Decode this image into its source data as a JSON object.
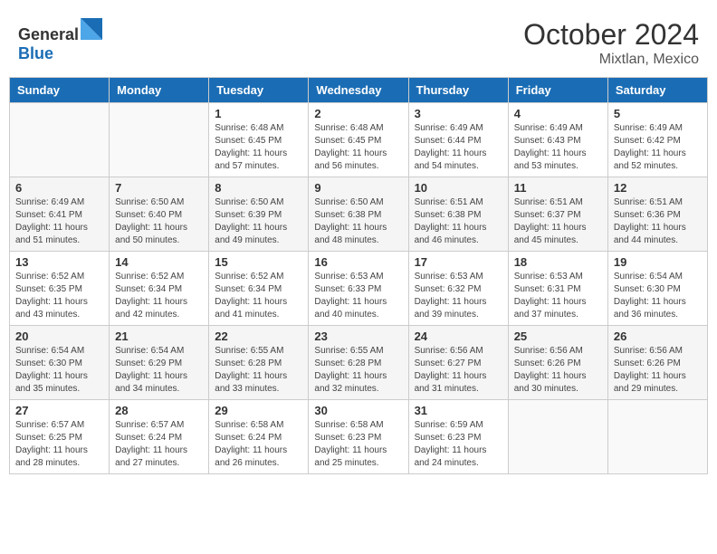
{
  "header": {
    "logo_general": "General",
    "logo_blue": "Blue",
    "month": "October 2024",
    "location": "Mixtlan, Mexico"
  },
  "weekdays": [
    "Sunday",
    "Monday",
    "Tuesday",
    "Wednesday",
    "Thursday",
    "Friday",
    "Saturday"
  ],
  "weeks": [
    [
      {
        "day": "",
        "info": ""
      },
      {
        "day": "",
        "info": ""
      },
      {
        "day": "1",
        "info": "Sunrise: 6:48 AM\nSunset: 6:45 PM\nDaylight: 11 hours and 57 minutes."
      },
      {
        "day": "2",
        "info": "Sunrise: 6:48 AM\nSunset: 6:45 PM\nDaylight: 11 hours and 56 minutes."
      },
      {
        "day": "3",
        "info": "Sunrise: 6:49 AM\nSunset: 6:44 PM\nDaylight: 11 hours and 54 minutes."
      },
      {
        "day": "4",
        "info": "Sunrise: 6:49 AM\nSunset: 6:43 PM\nDaylight: 11 hours and 53 minutes."
      },
      {
        "day": "5",
        "info": "Sunrise: 6:49 AM\nSunset: 6:42 PM\nDaylight: 11 hours and 52 minutes."
      }
    ],
    [
      {
        "day": "6",
        "info": "Sunrise: 6:49 AM\nSunset: 6:41 PM\nDaylight: 11 hours and 51 minutes."
      },
      {
        "day": "7",
        "info": "Sunrise: 6:50 AM\nSunset: 6:40 PM\nDaylight: 11 hours and 50 minutes."
      },
      {
        "day": "8",
        "info": "Sunrise: 6:50 AM\nSunset: 6:39 PM\nDaylight: 11 hours and 49 minutes."
      },
      {
        "day": "9",
        "info": "Sunrise: 6:50 AM\nSunset: 6:38 PM\nDaylight: 11 hours and 48 minutes."
      },
      {
        "day": "10",
        "info": "Sunrise: 6:51 AM\nSunset: 6:38 PM\nDaylight: 11 hours and 46 minutes."
      },
      {
        "day": "11",
        "info": "Sunrise: 6:51 AM\nSunset: 6:37 PM\nDaylight: 11 hours and 45 minutes."
      },
      {
        "day": "12",
        "info": "Sunrise: 6:51 AM\nSunset: 6:36 PM\nDaylight: 11 hours and 44 minutes."
      }
    ],
    [
      {
        "day": "13",
        "info": "Sunrise: 6:52 AM\nSunset: 6:35 PM\nDaylight: 11 hours and 43 minutes."
      },
      {
        "day": "14",
        "info": "Sunrise: 6:52 AM\nSunset: 6:34 PM\nDaylight: 11 hours and 42 minutes."
      },
      {
        "day": "15",
        "info": "Sunrise: 6:52 AM\nSunset: 6:34 PM\nDaylight: 11 hours and 41 minutes."
      },
      {
        "day": "16",
        "info": "Sunrise: 6:53 AM\nSunset: 6:33 PM\nDaylight: 11 hours and 40 minutes."
      },
      {
        "day": "17",
        "info": "Sunrise: 6:53 AM\nSunset: 6:32 PM\nDaylight: 11 hours and 39 minutes."
      },
      {
        "day": "18",
        "info": "Sunrise: 6:53 AM\nSunset: 6:31 PM\nDaylight: 11 hours and 37 minutes."
      },
      {
        "day": "19",
        "info": "Sunrise: 6:54 AM\nSunset: 6:30 PM\nDaylight: 11 hours and 36 minutes."
      }
    ],
    [
      {
        "day": "20",
        "info": "Sunrise: 6:54 AM\nSunset: 6:30 PM\nDaylight: 11 hours and 35 minutes."
      },
      {
        "day": "21",
        "info": "Sunrise: 6:54 AM\nSunset: 6:29 PM\nDaylight: 11 hours and 34 minutes."
      },
      {
        "day": "22",
        "info": "Sunrise: 6:55 AM\nSunset: 6:28 PM\nDaylight: 11 hours and 33 minutes."
      },
      {
        "day": "23",
        "info": "Sunrise: 6:55 AM\nSunset: 6:28 PM\nDaylight: 11 hours and 32 minutes."
      },
      {
        "day": "24",
        "info": "Sunrise: 6:56 AM\nSunset: 6:27 PM\nDaylight: 11 hours and 31 minutes."
      },
      {
        "day": "25",
        "info": "Sunrise: 6:56 AM\nSunset: 6:26 PM\nDaylight: 11 hours and 30 minutes."
      },
      {
        "day": "26",
        "info": "Sunrise: 6:56 AM\nSunset: 6:26 PM\nDaylight: 11 hours and 29 minutes."
      }
    ],
    [
      {
        "day": "27",
        "info": "Sunrise: 6:57 AM\nSunset: 6:25 PM\nDaylight: 11 hours and 28 minutes."
      },
      {
        "day": "28",
        "info": "Sunrise: 6:57 AM\nSunset: 6:24 PM\nDaylight: 11 hours and 27 minutes."
      },
      {
        "day": "29",
        "info": "Sunrise: 6:58 AM\nSunset: 6:24 PM\nDaylight: 11 hours and 26 minutes."
      },
      {
        "day": "30",
        "info": "Sunrise: 6:58 AM\nSunset: 6:23 PM\nDaylight: 11 hours and 25 minutes."
      },
      {
        "day": "31",
        "info": "Sunrise: 6:59 AM\nSunset: 6:23 PM\nDaylight: 11 hours and 24 minutes."
      },
      {
        "day": "",
        "info": ""
      },
      {
        "day": "",
        "info": ""
      }
    ]
  ]
}
